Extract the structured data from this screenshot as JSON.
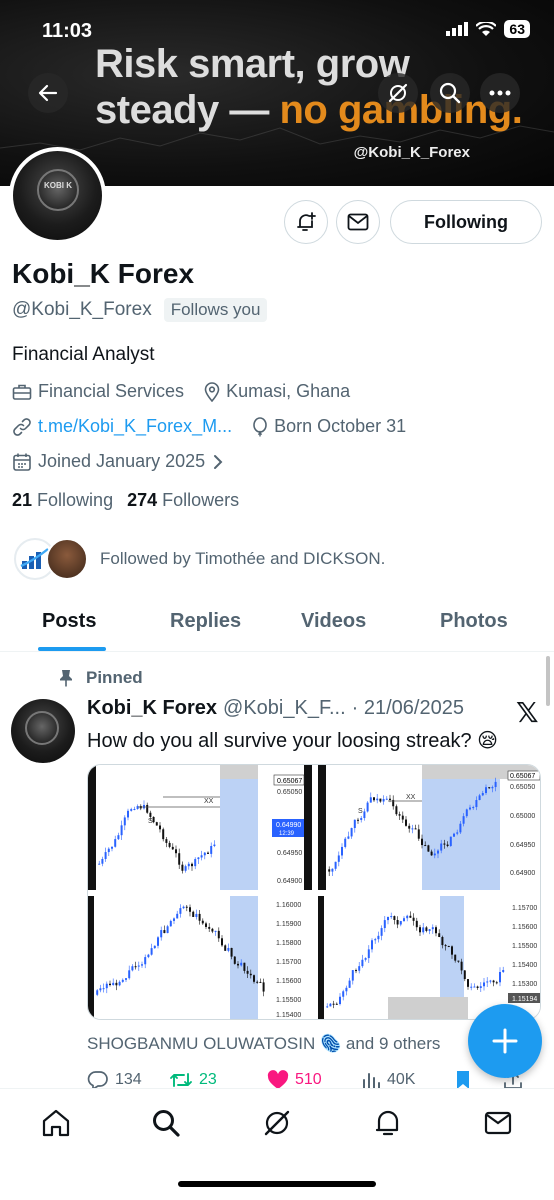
{
  "status_bar": {
    "time": "11:03",
    "battery": "63"
  },
  "banner": {
    "line1": "Risk smart, grow",
    "line2_prefix": "steady —",
    "line2_highlight": "no gambling.",
    "handle": "@Kobi_K_Forex",
    "highlight_color": "#e38a1c"
  },
  "avatar": {
    "logo_text": "KOBI K"
  },
  "header_icons": [
    "back-arrow-icon",
    "grok-icon",
    "search-icon",
    "more-icon"
  ],
  "actions": {
    "following_label": "Following"
  },
  "profile": {
    "name": "Kobi_K Forex",
    "handle": "@Kobi_K_Forex",
    "follows_you": "Follows you",
    "bio": "Financial Analyst",
    "category": "Financial Services",
    "location": "Kumasi, Ghana",
    "website": "t.me/Kobi_K_Forex_M...",
    "birthday": "Born October 31",
    "joined": "Joined January 2025",
    "following_count": "21",
    "following_label": "Following",
    "followers_count": "274",
    "followers_label": "Followers",
    "followed_by": "Followed by Timothée and DICKSON."
  },
  "tabs": [
    "Posts",
    "Replies",
    "Videos",
    "Photos"
  ],
  "tweet": {
    "pinned_label": "Pinned",
    "author": "Kobi_K Forex",
    "handle": "@Kobi_K_F...",
    "date": "· 21/06/2025",
    "text": "How do you all survive your loosing streak? 😪",
    "liked_by": "SHOGBANMU OLUWATOSIN 🫆  and 9 others",
    "replies": "134",
    "retweets": "23",
    "likes": "510",
    "views": "40K",
    "chart_labels": {
      "tl": [
        "0.65067",
        "0.65050",
        "0.64950",
        "0.64900"
      ],
      "tl_current": "0.64990",
      "tl_timer": "12:39",
      "tr": [
        "0.65067",
        "0.65050",
        "0.65000",
        "0.64950",
        "0.64900"
      ],
      "bl": [
        "1.16000",
        "1.15900",
        "1.15800",
        "1.15700",
        "1.15600",
        "1.15500",
        "1.15400"
      ],
      "br": [
        "1.15700",
        "1.15600",
        "1.15500",
        "1.15400",
        "1.15300",
        "1.15194"
      ]
    }
  },
  "colors": {
    "accent": "#1d9bf0",
    "retweet": "#00ba7c",
    "like": "#f91880"
  },
  "bottom_nav": [
    "home-icon",
    "search-icon",
    "grok-icon",
    "notifications-icon",
    "messages-icon"
  ]
}
